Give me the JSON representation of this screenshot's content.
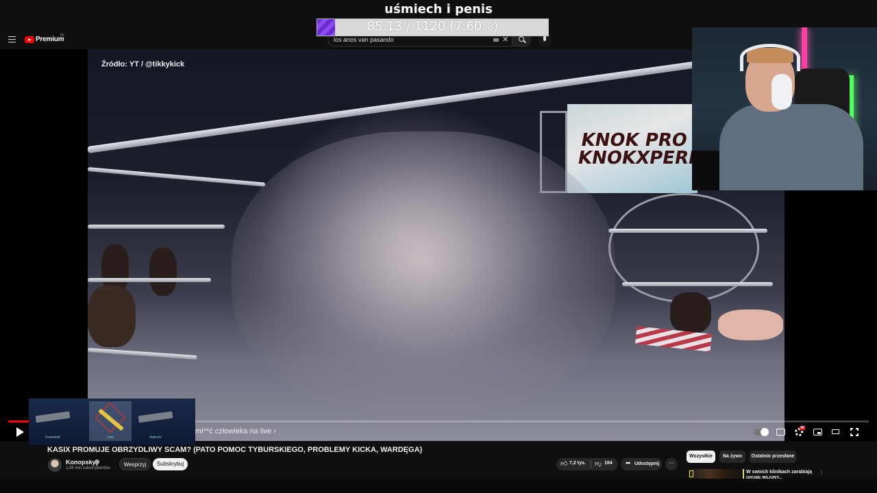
{
  "overlay": {
    "title": "uśmiech i penis",
    "goal_text": "85.13 / 1120 (7.60%)",
    "goal_fraction": 0.076
  },
  "header": {
    "premium_label": "Premium",
    "region_label": "PL",
    "search_value": "los anos van pasando"
  },
  "player": {
    "source_label": "Źródło: YT / @tikkykick",
    "banner_text": "KNOK PRO\nKNOKXPERIENC",
    "chapter_label": "mi**ć człowieka na live ›",
    "progress_fraction": 0.025,
    "hd_badge": "4K",
    "skins": [
      {
        "name": "Freehand"
      },
      {
        "name": "Lore"
      },
      {
        "name": "Asiimov"
      }
    ]
  },
  "video": {
    "title": "KASIX PROMUJE OBRZYDLIWY SCAM? (PATO POMOC TYBURSKIEGO, PROBLEMY KICKA, WARDĘGA)",
    "channel_name": "Konopskyy",
    "subscriber_count": "2,08 mln subskrybentów",
    "join_label": "Wesprzyj",
    "subscribe_label": "Subskrybuj",
    "like_count": "7,2 tys.",
    "dislike_count": "164",
    "share_label": "Udostępnij",
    "more_label": "···"
  },
  "sidebar": {
    "chips": [
      {
        "label": "Wszystkie",
        "active": true
      },
      {
        "label": "Na żywo",
        "active": false
      },
      {
        "label": "Ostatnio przesłane",
        "active": false
      }
    ],
    "rec_title": "W swoich klinikach zarabiają",
    "rec_subtitle": "GRUBE MILIONY..."
  },
  "colors": {
    "accent": "#ff0000",
    "goal_fill": "#7b3de8",
    "background": "#0f0f0f"
  }
}
